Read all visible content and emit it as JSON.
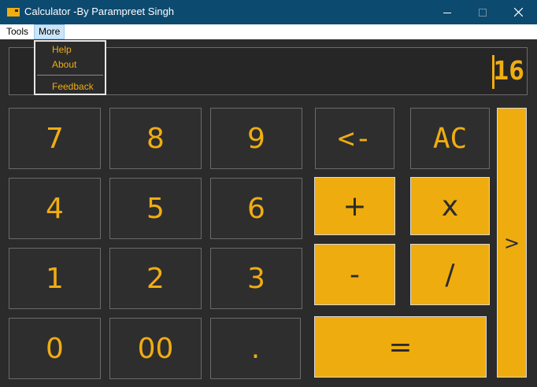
{
  "window": {
    "title": "Calculator -By Parampreet Singh"
  },
  "menu": {
    "tools_label": "Tools",
    "more_label": "More"
  },
  "more_menu": {
    "help": "Help",
    "about": "About",
    "feedback": "Feedback"
  },
  "display": {
    "value": "16"
  },
  "keys": {
    "seven": "7",
    "eight": "8",
    "nine": "9",
    "four": "4",
    "five": "5",
    "six": "6",
    "one": "1",
    "two": "2",
    "three": "3",
    "zero": "0",
    "double_zero": "00",
    "dot": ".",
    "backspace": "<-",
    "clear": "AC",
    "plus": "+",
    "multiply": "x",
    "minus": "-",
    "divide": "/",
    "equals": "=",
    "next": ">"
  },
  "colors": {
    "accent": "#f0ad12",
    "titlebar": "#0d4a6f",
    "background": "#2b2b2b"
  }
}
